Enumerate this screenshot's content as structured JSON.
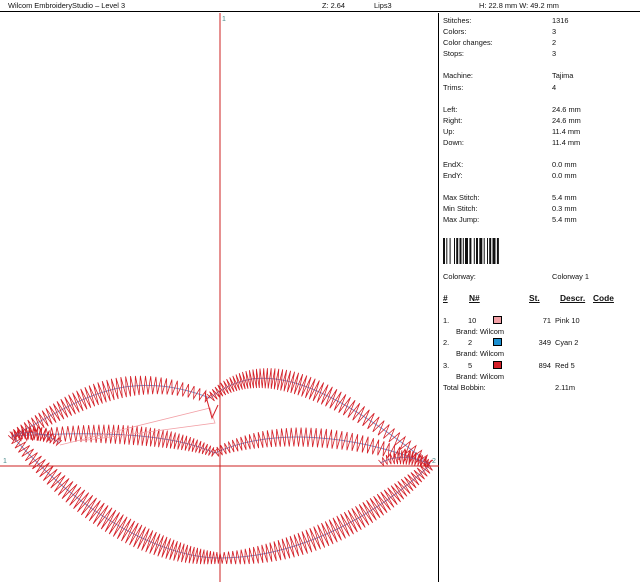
{
  "header": {
    "app_title": "Wilcom EmbroideryStudio – Level 3",
    "zoom": "Z: 2.64",
    "design_name": "Lips3",
    "dimensions": "H: 22.8 mm  W: 49.2 mm"
  },
  "axes": {
    "top_label": "1",
    "left_label": "1",
    "right_label": "2"
  },
  "stats": {
    "stitches_label": "Stitches:",
    "stitches": "1316",
    "colors_label": "Colors:",
    "colors": "3",
    "color_changes_label": "Color changes:",
    "color_changes": "2",
    "stops_label": "Stops:",
    "stops": "3",
    "machine_label": "Machine:",
    "machine": "Tajima",
    "trims_label": "Trims:",
    "trims": "4",
    "left_label": "Left:",
    "left": "24.6 mm",
    "right_label": "Right:",
    "right": "24.6 mm",
    "up_label": "Up:",
    "up": "11.4 mm",
    "down_label": "Down:",
    "down": "11.4 mm",
    "endx_label": "EndX:",
    "endx": "0.0 mm",
    "endy_label": "EndY:",
    "endy": "0.0 mm",
    "max_stitch_label": "Max Stitch:",
    "max_stitch": "5.4 mm",
    "min_stitch_label": "Min Stitch:",
    "min_stitch": "0.3 mm",
    "max_jump_label": "Max Jump:",
    "max_jump": "5.4 mm",
    "colorway_label": "Colorway:",
    "colorway": "Colorway 1"
  },
  "color_table": {
    "headers": {
      "num": "#",
      "n": "N#",
      "st": "St.",
      "descr": "Descr.",
      "code": "Code"
    },
    "items": [
      {
        "index": "1.",
        "n": "10",
        "color": "#f2a0a6",
        "stitches": "71",
        "descr": "Pink 10",
        "brand": "Brand: Wilcom"
      },
      {
        "index": "2.",
        "n": "2",
        "color": "#1a8fd0",
        "stitches": "349",
        "descr": "Cyan 2",
        "brand": "Brand: Wilcom"
      },
      {
        "index": "3.",
        "n": "5",
        "color": "#d42028",
        "stitches": "894",
        "descr": "Red 5",
        "brand": "Brand: Wilcom"
      }
    ],
    "total_bobbin_label": "Total Bobbin:",
    "total_bobbin": "2.11m"
  },
  "colors": {
    "axis": "#cc2020",
    "thread_red": "#d42028",
    "thread_cyan": "#5a7fc8",
    "thread_pink": "#f2a0a6"
  }
}
